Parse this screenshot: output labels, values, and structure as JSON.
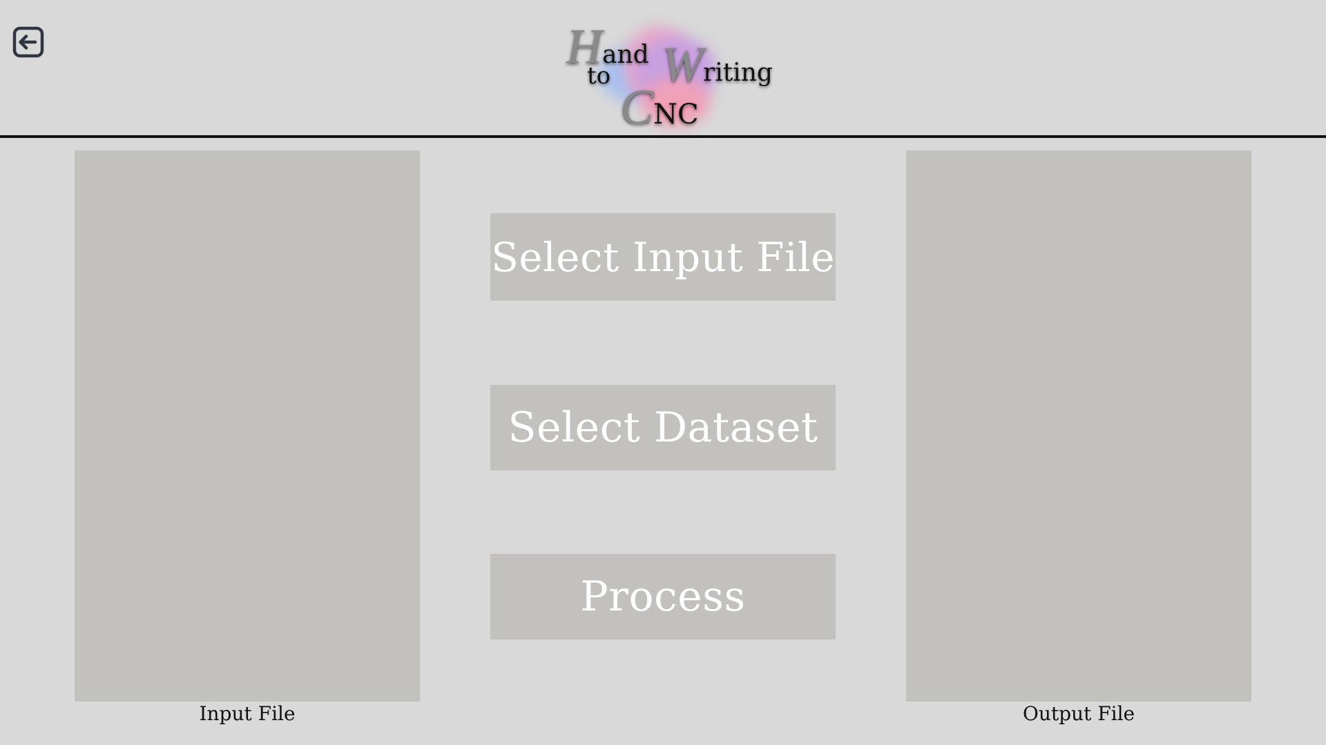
{
  "header": {
    "back_icon": "back-arrow-icon",
    "logo": {
      "hand_cap": "H",
      "hand_rest": "and",
      "writing_cap": "W",
      "writing_rest": "riting",
      "to": "to",
      "cnc_cap": "C",
      "cnc_rest": "NC"
    }
  },
  "actions": {
    "select_input_label": "Select Input File",
    "select_dataset_label": "Select Dataset",
    "process_label": "Process"
  },
  "panels": {
    "input_caption": "Input File",
    "output_caption": "Output File"
  },
  "colors": {
    "background": "#d9d9d9",
    "panel": "#c2c1be",
    "button_text": "#ffffff",
    "rule": "#111111"
  }
}
